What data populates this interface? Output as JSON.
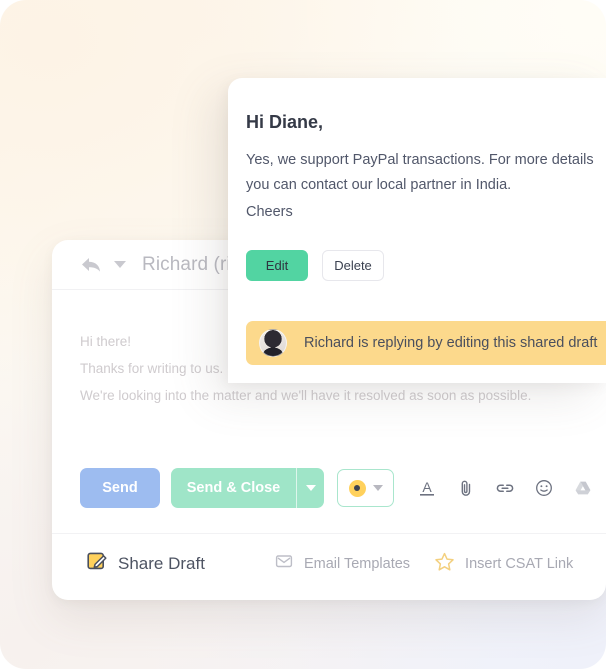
{
  "draft_card": {
    "greeting": "Hi Diane,",
    "paragraph_line1": "Yes, we support PayPal transactions. For more details",
    "paragraph_line2": "you can contact our local partner in India.",
    "signoff": "Cheers",
    "edit_label": "Edit",
    "delete_label": "Delete",
    "notice": {
      "text": "Richard is replying by editing this shared draft",
      "avatar_icon": "user-avatar",
      "background_color": "#fcd98c"
    },
    "accent_color": "#52d4a2"
  },
  "composer": {
    "header": {
      "reply_icon": "reply-arrow-icon",
      "caret_icon": "chevron-down-icon",
      "recipient": "Richard (ric"
    },
    "quoted_body": {
      "line1": "Hi there!",
      "line2": "Thanks for writing to us.",
      "line3": "We're looking into the matter and we'll have it resolved as soon as possible."
    },
    "toolbar": {
      "send_label": "Send",
      "send_close_label": "Send & Close",
      "send_close_caret_icon": "chevron-down-icon",
      "status_badge_icon": "status-dot-icon",
      "status_caret_icon": "chevron-down-icon",
      "send_color": "#9dbcf0",
      "send_close_color": "#9fe5c8",
      "icons": [
        {
          "name": "text-format-icon",
          "glyph": "A"
        },
        {
          "name": "paperclip-icon",
          "glyph": ""
        },
        {
          "name": "link-icon",
          "glyph": ""
        },
        {
          "name": "emoji-icon",
          "glyph": ""
        },
        {
          "name": "google-drive-icon",
          "glyph": ""
        },
        {
          "name": "image-icon",
          "glyph": ""
        },
        {
          "name": "lock-icon",
          "glyph": ""
        }
      ]
    },
    "actions": [
      {
        "name": "share-draft",
        "icon": "edit-square-icon",
        "label": "Share Draft",
        "muted": false
      },
      {
        "name": "email-templates",
        "icon": "envelope-icon",
        "label": "Email Templates",
        "muted": true
      },
      {
        "name": "insert-csat-link",
        "icon": "star-icon",
        "label": "Insert CSAT Link",
        "muted": true
      }
    ]
  }
}
